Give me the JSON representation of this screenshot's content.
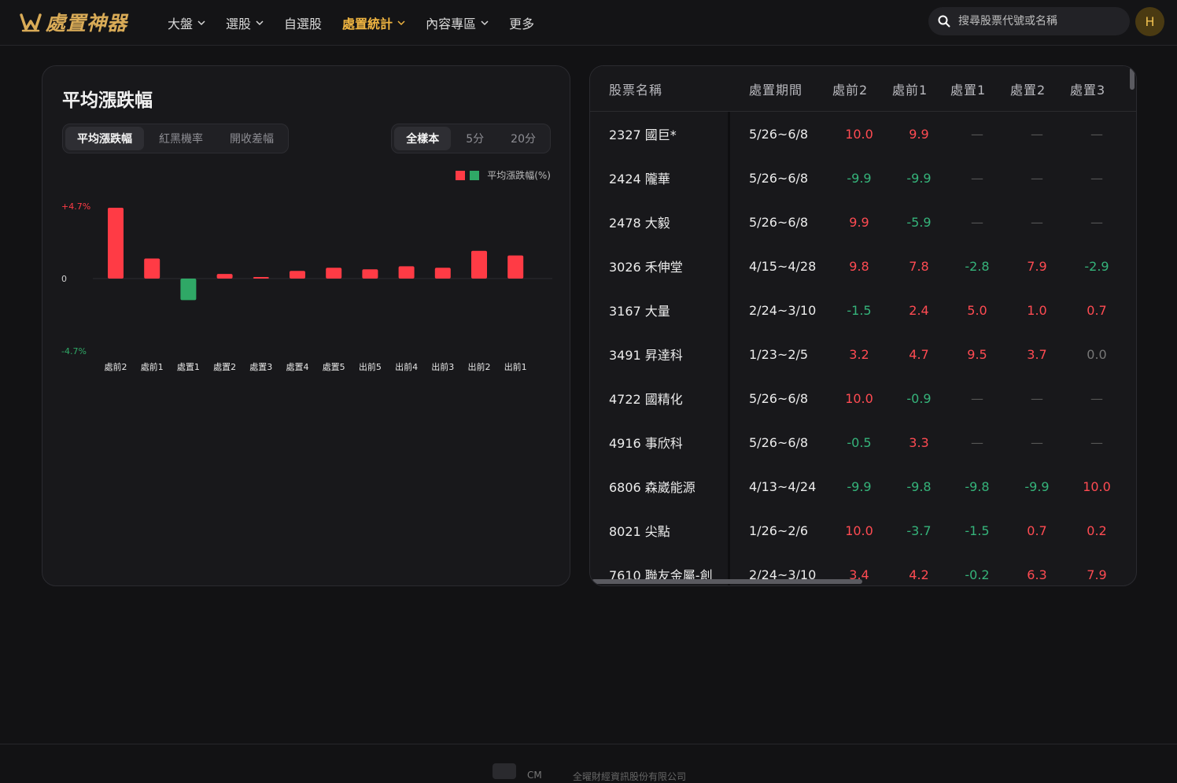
{
  "header": {
    "logo_text": "處置神器",
    "nav": [
      {
        "label": "大盤",
        "has_dropdown": true,
        "active": false
      },
      {
        "label": "選股",
        "has_dropdown": true,
        "active": false
      },
      {
        "label": "自選股",
        "has_dropdown": false,
        "active": false
      },
      {
        "label": "處置統計",
        "has_dropdown": true,
        "active": true
      },
      {
        "label": "內容專區",
        "has_dropdown": true,
        "active": false
      },
      {
        "label": "更多",
        "has_dropdown": false,
        "active": false
      }
    ],
    "search_placeholder": "搜尋股票代號或名稱",
    "avatar_initial": "H"
  },
  "chart_panel": {
    "title": "平均漲跌幅",
    "metric_tabs": [
      "平均漲跌幅",
      "紅黑機率",
      "開收差幅"
    ],
    "metric_active": 0,
    "sample_tabs": [
      "全樣本",
      "5分",
      "20分"
    ],
    "sample_active": 0,
    "legend_label": "平均漲跌幅(%)"
  },
  "chart_data": {
    "type": "bar",
    "categories": [
      "處前2",
      "處前1",
      "處置1",
      "處置2",
      "處置3",
      "處置4",
      "處置5",
      "出前5",
      "出前4",
      "出前3",
      "出前2",
      "出前1"
    ],
    "series": [
      {
        "name": "平均漲跌幅(%)",
        "values": [
          4.6,
          1.3,
          -1.4,
          0.3,
          0.05,
          0.5,
          0.7,
          0.6,
          0.8,
          0.7,
          1.8,
          1.5
        ]
      }
    ],
    "yticks": [
      "+4.7%",
      "0",
      "-4.7%"
    ],
    "ylim": [
      -4.7,
      4.7
    ],
    "colors": {
      "up": "#ff3b45",
      "down": "#2fa866"
    }
  },
  "table": {
    "columns": [
      "股票名稱",
      "處置期間",
      "處前2",
      "處前1",
      "處置1",
      "處置2",
      "處置3"
    ],
    "rows": [
      {
        "name": "2327 國巨*",
        "period": "5/26~6/8",
        "values": [
          "10.0",
          "9.9",
          "—",
          "—",
          "—"
        ]
      },
      {
        "name": "2424 隴華",
        "period": "5/26~6/8",
        "values": [
          "-9.9",
          "-9.9",
          "—",
          "—",
          "—"
        ]
      },
      {
        "name": "2478 大毅",
        "period": "5/26~6/8",
        "values": [
          "9.9",
          "-5.9",
          "—",
          "—",
          "—"
        ]
      },
      {
        "name": "3026 禾伸堂",
        "period": "4/15~4/28",
        "values": [
          "9.8",
          "7.8",
          "-2.8",
          "7.9",
          "-2.9"
        ]
      },
      {
        "name": "3167 大量",
        "period": "2/24~3/10",
        "values": [
          "-1.5",
          "2.4",
          "5.0",
          "1.0",
          "0.7"
        ]
      },
      {
        "name": "3491 昇達科",
        "period": "1/23~2/5",
        "values": [
          "3.2",
          "4.7",
          "9.5",
          "3.7",
          "0.0"
        ]
      },
      {
        "name": "4722 國精化",
        "period": "5/26~6/8",
        "values": [
          "10.0",
          "-0.9",
          "—",
          "—",
          "—"
        ]
      },
      {
        "name": "4916 事欣科",
        "period": "5/26~6/8",
        "values": [
          "-0.5",
          "3.3",
          "—",
          "—",
          "—"
        ]
      },
      {
        "name": "6806 森崴能源",
        "period": "4/13~4/24",
        "values": [
          "-9.9",
          "-9.8",
          "-9.8",
          "-9.9",
          "10.0"
        ]
      },
      {
        "name": "8021 尖點",
        "period": "1/26~2/6",
        "values": [
          "10.0",
          "-3.7",
          "-1.5",
          "0.7",
          "0.2"
        ]
      },
      {
        "name": "7610 聯友金屬-創",
        "period": "2/24~3/10",
        "values": [
          "3.4",
          "4.2",
          "-0.2",
          "6.3",
          "7.9"
        ]
      }
    ]
  },
  "footer": {
    "brand": "CM",
    "copyright": "全曜財經資訊股份有限公司"
  }
}
